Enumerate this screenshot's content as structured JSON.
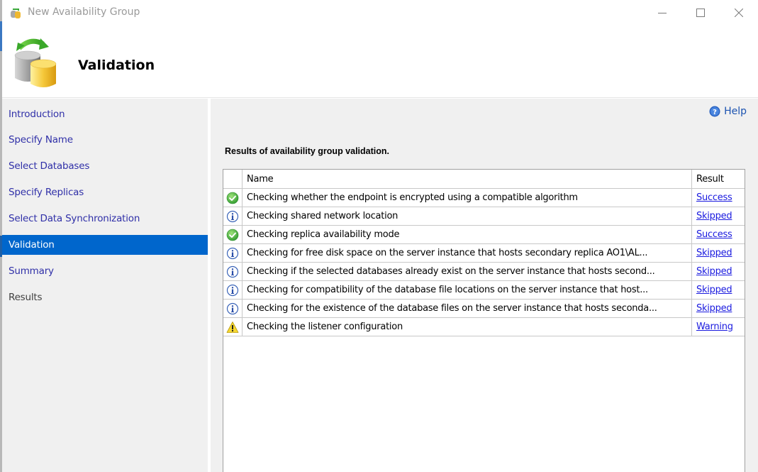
{
  "window": {
    "title": "New Availability Group",
    "controls": {
      "minimize": "minimize",
      "maximize": "maximize",
      "close": "close"
    }
  },
  "header": {
    "page_title": "Validation",
    "icon": "database-sync-icon"
  },
  "sidebar": {
    "items": [
      {
        "label": "Introduction",
        "state": "link"
      },
      {
        "label": "Specify Name",
        "state": "link"
      },
      {
        "label": "Select Databases",
        "state": "link"
      },
      {
        "label": "Specify Replicas",
        "state": "link"
      },
      {
        "label": "Select Data Synchronization",
        "state": "link"
      },
      {
        "label": "Validation",
        "state": "active"
      },
      {
        "label": "Summary",
        "state": "link"
      },
      {
        "label": "Results",
        "state": "disabled"
      }
    ]
  },
  "main": {
    "help_label": "Help",
    "section_label": "Results of availability group validation.",
    "table": {
      "columns": [
        "",
        "Name",
        "Result"
      ],
      "rows": [
        {
          "status": "success",
          "name": "Checking whether the endpoint is encrypted using a compatible algorithm",
          "result": "Success"
        },
        {
          "status": "info",
          "name": "Checking shared network location",
          "result": "Skipped"
        },
        {
          "status": "success",
          "name": "Checking replica availability mode",
          "result": "Success"
        },
        {
          "status": "info",
          "name": "Checking for free disk space on the server instance that hosts secondary replica AO1\\AL...",
          "result": "Skipped"
        },
        {
          "status": "info",
          "name": "Checking if the selected databases already exist on the server instance that hosts second...",
          "result": "Skipped"
        },
        {
          "status": "info",
          "name": "Checking for compatibility of the database file locations on the server instance that host...",
          "result": "Skipped"
        },
        {
          "status": "info",
          "name": "Checking for the existence of the database files on the server instance that hosts seconda...",
          "result": "Skipped"
        },
        {
          "status": "warning",
          "name": "Checking the listener configuration",
          "result": "Warning"
        }
      ]
    }
  },
  "colors": {
    "accent": "#0066cc",
    "link": "#1a1adf",
    "nav_link": "#3030a8",
    "panel_bg": "#f0f0f0",
    "success": "#3aa83a",
    "info": "#2a5ab0",
    "warning": "#f0d020"
  }
}
